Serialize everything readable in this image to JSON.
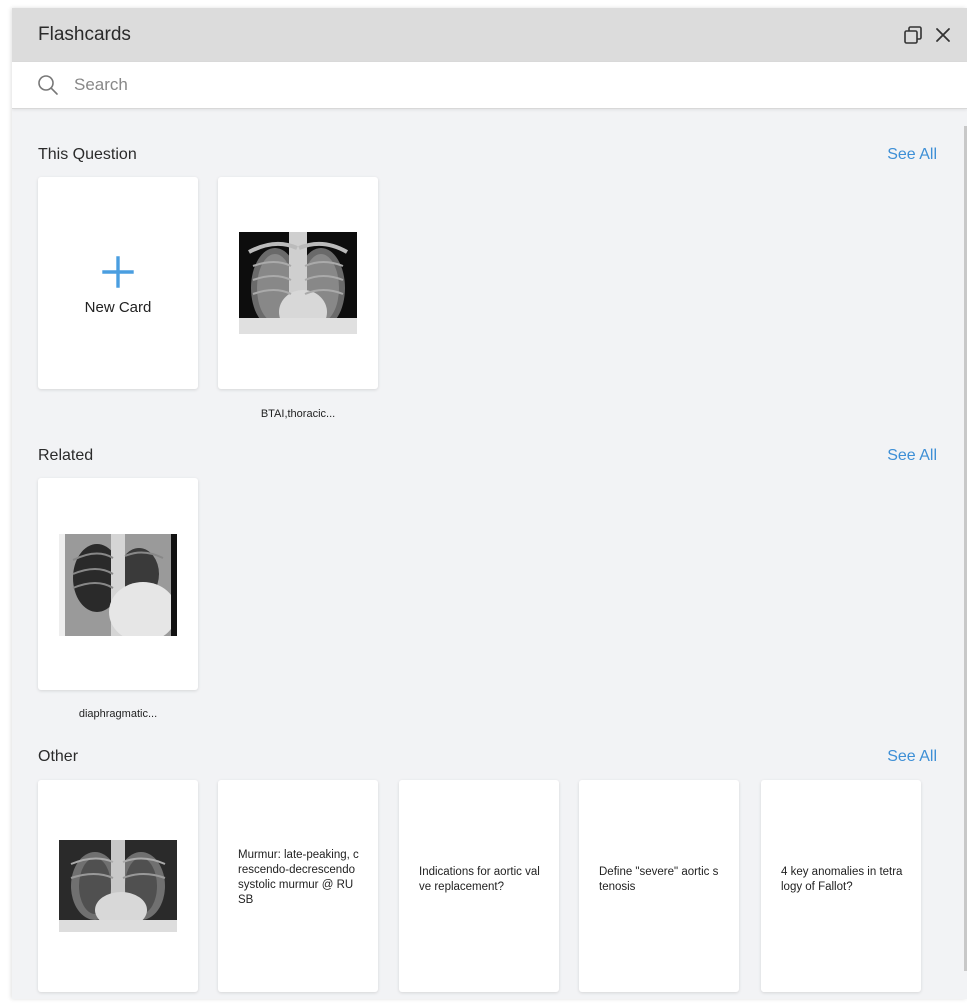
{
  "window": {
    "title": "Flashcards",
    "restore_icon": "restore-window-icon",
    "close_icon": "close-icon"
  },
  "search": {
    "placeholder": "Search",
    "value": ""
  },
  "sections": {
    "this_question": {
      "title": "This Question",
      "see_all": "See All",
      "new_card_label": "New Card",
      "cards": [
        {
          "caption": "BTAI,thoracic..."
        }
      ]
    },
    "related": {
      "title": "Related",
      "see_all": "See All",
      "cards": [
        {
          "caption": "diaphragmatic..."
        }
      ]
    },
    "other": {
      "title": "Other",
      "see_all": "See All",
      "cards": [
        {
          "text": ""
        },
        {
          "text": "Murmur: late-peaking, crescendo-decrescendo systolic murmur @ RUSB"
        },
        {
          "text": "Indications for aortic valve replacement?"
        },
        {
          "text": "Define \"severe\" aortic stenosis"
        },
        {
          "text": "4 key anomalies in tetralogy of Fallot?"
        }
      ]
    }
  },
  "colors": {
    "accent": "#3d8fd6",
    "panel_bg": "#f2f3f5",
    "titlebar_bg": "#dcdcdc"
  }
}
